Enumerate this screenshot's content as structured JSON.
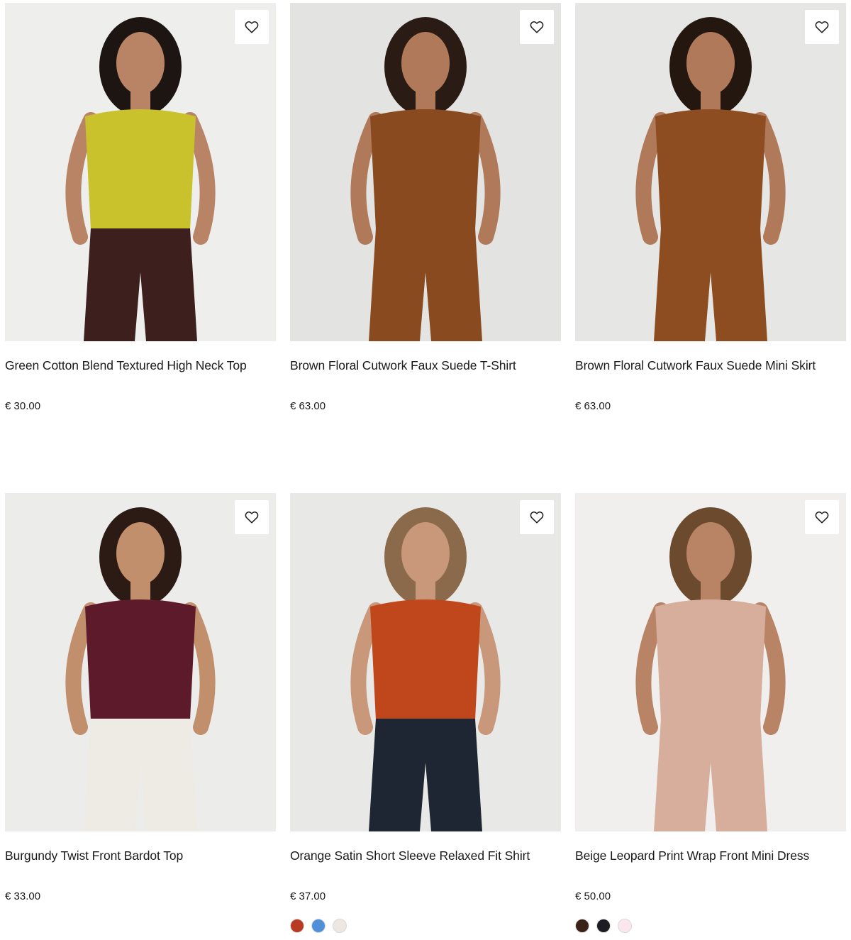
{
  "products": [
    {
      "name": "Green Cotton Blend Textured High Neck Top",
      "price": "€ 30.00",
      "wishlist_icon": "heart-outline-icon",
      "photo": {
        "bg": "#eeeeec",
        "top": "#c9c22d",
        "bottom": "#3d1f1e",
        "skin": "#b98466",
        "hair": "#1c1512"
      }
    },
    {
      "name": "Brown Floral Cutwork Faux Suede T-Shirt",
      "price": "€ 63.00",
      "wishlist_icon": "heart-outline-icon",
      "photo": {
        "bg": "#e3e3e1",
        "top": "#8a4a1f",
        "bottom": "#8a4a1f",
        "skin": "#b07a5a",
        "hair": "#2a1c14"
      }
    },
    {
      "name": "Brown Floral Cutwork Faux Suede Mini Skirt",
      "price": "€ 63.00",
      "wishlist_icon": "heart-outline-icon",
      "photo": {
        "bg": "#e6e6e4",
        "top": "#8e4d20",
        "bottom": "#8e4d20",
        "skin": "#b07a5a",
        "hair": "#241710"
      }
    },
    {
      "name": "Burgundy Twist Front Bardot Top",
      "price": "€ 33.00",
      "wishlist_icon": "heart-outline-icon",
      "photo": {
        "bg": "#ececea",
        "top": "#5c1a2a",
        "bottom": "#eeebe4",
        "skin": "#c28f6c",
        "hair": "#2b1b14"
      }
    },
    {
      "name": "Orange Satin Short Sleeve Relaxed Fit Shirt",
      "price": "€ 37.00",
      "wishlist_icon": "heart-outline-icon",
      "photo": {
        "bg": "#e8e8e6",
        "top": "#c0471c",
        "bottom": "#1e2633",
        "skin": "#c9977a",
        "hair": "#8a6a4a"
      },
      "swatches": [
        {
          "name": "orange",
          "color": "#b93a22"
        },
        {
          "name": "blue",
          "color": "#5090d8"
        },
        {
          "name": "cream",
          "color": "#ece8e1"
        }
      ]
    },
    {
      "name": "Beige Leopard Print Wrap Front Mini Dress",
      "price": "€ 50.00",
      "wishlist_icon": "heart-outline-icon",
      "photo": {
        "bg": "#f0efed",
        "top": "#d7ae9b",
        "bottom": "#d7ae9b",
        "skin": "#b98466",
        "hair": "#6b4a2e"
      },
      "swatches": [
        {
          "name": "brown",
          "color": "#3b2219"
        },
        {
          "name": "black",
          "color": "#1c1c22"
        },
        {
          "name": "pink",
          "color": "#fbe6ee"
        }
      ]
    }
  ]
}
